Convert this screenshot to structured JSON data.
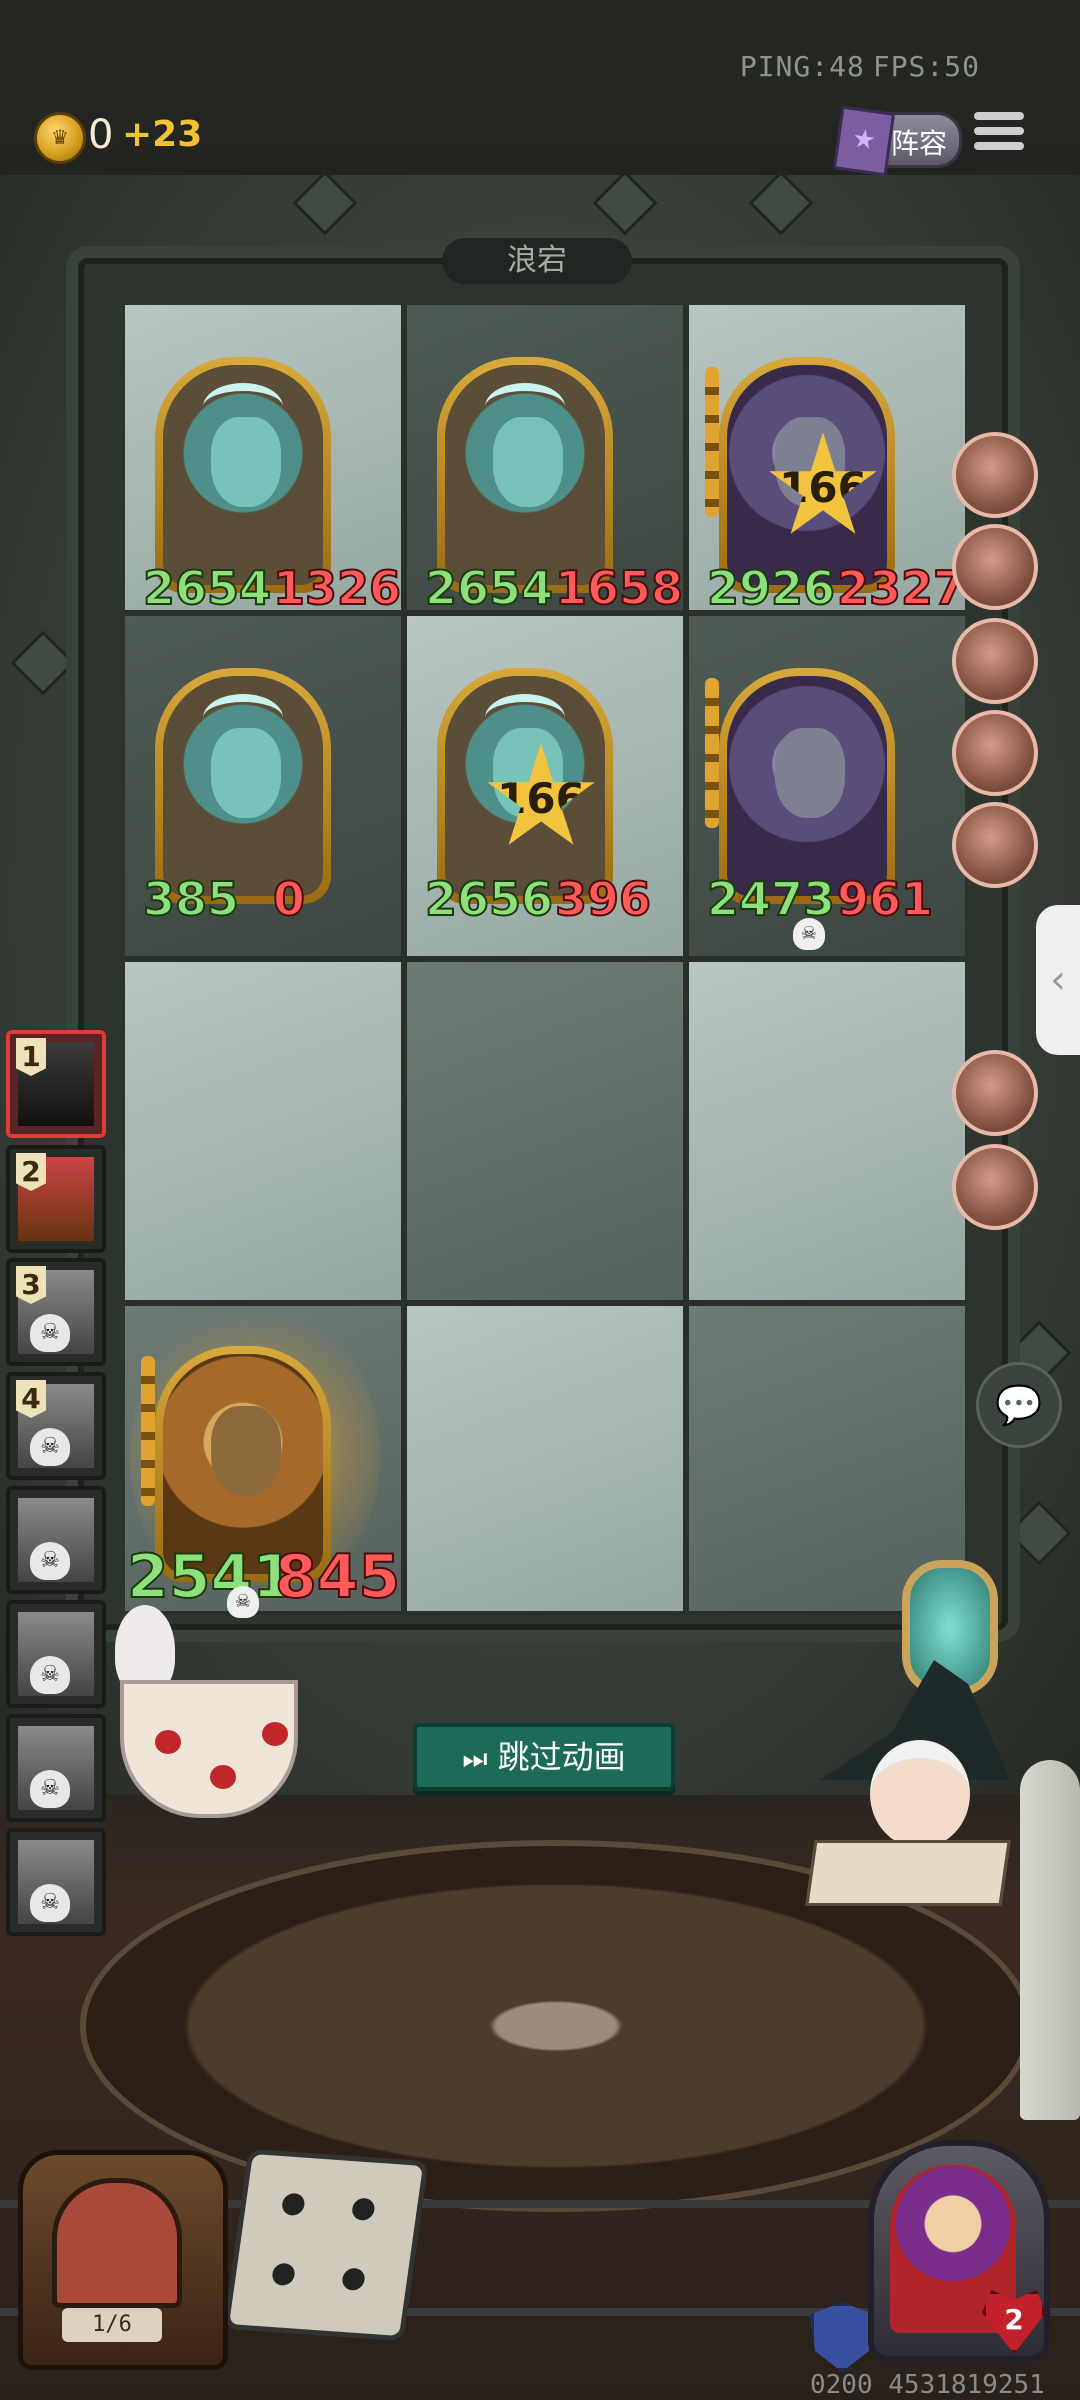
{
  "hud": {
    "ping_label": "PING:48",
    "fps_label": "FPS:50",
    "coins": "0",
    "coin_bonus": "+23",
    "lineup_label": "阵容"
  },
  "board": {
    "title": "浪宕",
    "rows": [
      [
        {
          "attack": "2654",
          "health": "1326",
          "art": "ghost",
          "star": null,
          "tier_bar": false,
          "skull": false
        },
        {
          "attack": "2654",
          "health": "1658",
          "art": "ghost",
          "star": null,
          "tier_bar": false,
          "skull": false
        },
        {
          "attack": "2926",
          "health": "2327",
          "art": "rat",
          "star": "166",
          "tier_bar": true,
          "skull": false
        }
      ],
      [
        {
          "attack": "385",
          "health": "0",
          "art": "ghost",
          "star": null,
          "tier_bar": false,
          "skull": false
        },
        {
          "attack": "2656",
          "health": "396",
          "art": "ghost",
          "star": "166",
          "tier_bar": false,
          "skull": false
        },
        {
          "attack": "2473",
          "health": "961",
          "art": "rat",
          "star": null,
          "tier_bar": true,
          "skull": true
        }
      ]
    ],
    "player_unit": {
      "attack": "2541",
      "health": "845",
      "art": "golden",
      "skull": true
    }
  },
  "opponents": [
    {
      "rank": "1",
      "state": "active"
    },
    {
      "rank": "2",
      "state": "alive"
    },
    {
      "rank": "3",
      "state": "dead"
    },
    {
      "rank": "4",
      "state": "dead"
    },
    {
      "rank": "",
      "state": "dead"
    },
    {
      "rank": "",
      "state": "dead"
    },
    {
      "rank": "",
      "state": "dead"
    },
    {
      "rank": "",
      "state": "dead"
    }
  ],
  "relics_count": 7,
  "skip_button": {
    "label": "跳过动画"
  },
  "bottom": {
    "bag_counter": "1/6",
    "hero_health": "2",
    "game_id": "0200 4531819251"
  },
  "colors": {
    "attack": "#8de07a",
    "health": "#ff5a5a",
    "skip_button": "#1b6b58",
    "active_opponent": "#e23b3b"
  }
}
